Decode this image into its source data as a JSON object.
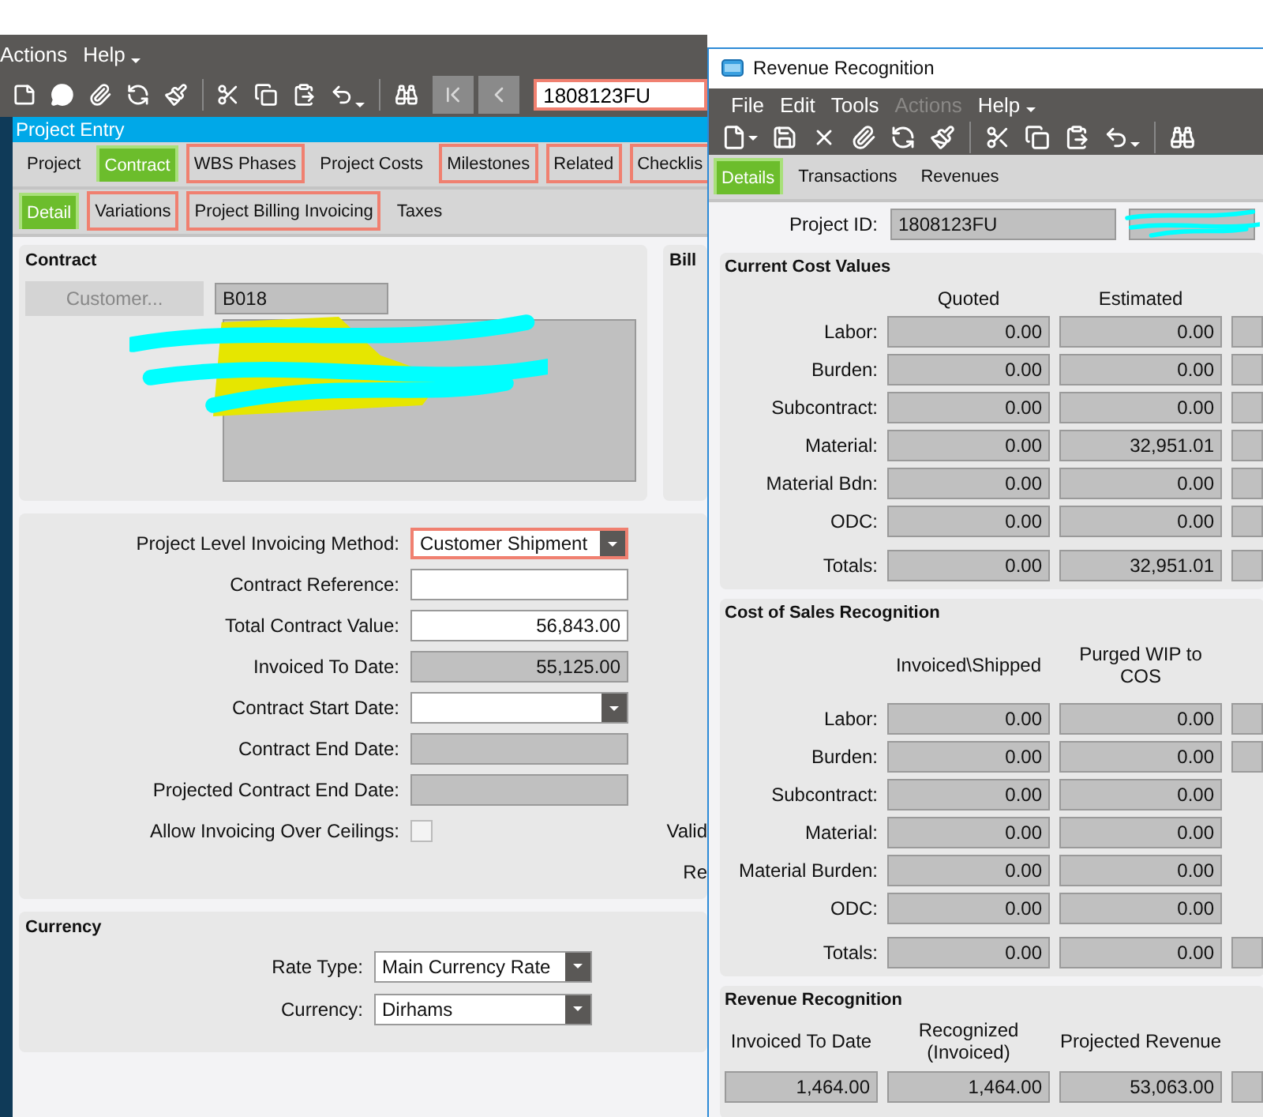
{
  "project_entry": {
    "menu": [
      {
        "label": "Actions",
        "disabled": false
      },
      {
        "label": "Help",
        "disabled": false
      }
    ],
    "record_field": {
      "value": "1808123FU",
      "highlighted": true
    },
    "title": "Project Entry",
    "tabs": [
      {
        "label": "Project",
        "selected": false,
        "highlighted": false
      },
      {
        "label": "Contract",
        "selected": true,
        "highlighted": false
      },
      {
        "label": "WBS Phases",
        "selected": false,
        "highlighted": true
      },
      {
        "label": "Project Costs",
        "selected": false,
        "highlighted": false
      },
      {
        "label": "Milestones",
        "selected": false,
        "highlighted": true
      },
      {
        "label": "Related",
        "selected": false,
        "highlighted": true
      },
      {
        "label": "Checklis",
        "selected": false,
        "highlighted": true
      }
    ],
    "subtabs": [
      {
        "label": "Detail",
        "selected": true,
        "highlighted": false
      },
      {
        "label": "Variations",
        "selected": false,
        "highlighted": true
      },
      {
        "label": "Project Billing Invoicing",
        "selected": false,
        "highlighted": true
      },
      {
        "label": "Taxes",
        "selected": false,
        "highlighted": false
      }
    ],
    "contract": {
      "heading": "Contract",
      "customer_button": {
        "label": "Customer...",
        "disabled": true
      },
      "customer_id": "B018"
    },
    "bill_to": {
      "heading": "Bill"
    },
    "fields": [
      {
        "label": "Project Level Invoicing Method:",
        "kind": "dropdown",
        "value": "Customer Shipment",
        "highlighted": true
      },
      {
        "label": "Contract Reference:",
        "kind": "text",
        "highlighted": false
      },
      {
        "label": "Total Contract Value:",
        "kind": "text",
        "value": "56,843.00",
        "highlighted": false
      },
      {
        "label": "Invoiced To Date:",
        "kind": "readonly",
        "value": "55,125.00",
        "highlighted": false
      },
      {
        "label": "Contract Start Date:",
        "kind": "dropdown",
        "highlighted": false
      },
      {
        "label": "Contract End Date:",
        "kind": "readonly",
        "highlighted": false
      },
      {
        "label": "Projected Contract End Date:",
        "kind": "readonly",
        "highlighted": false
      },
      {
        "label": "Allow Invoicing Over Ceilings:",
        "kind": "checkbox",
        "checked": false,
        "side_label": "Valid"
      },
      {
        "kind": "blank",
        "side_label": "Re"
      }
    ],
    "currency": {
      "heading": "Currency",
      "fields": [
        {
          "label": "Rate Type:",
          "value": "Main Currency Rate"
        },
        {
          "label": "Currency:",
          "value": "Dirhams"
        }
      ]
    }
  },
  "revenue_recognition": {
    "title": "Revenue Recognition",
    "menu": [
      {
        "label": "File",
        "disabled": false
      },
      {
        "label": "Edit",
        "disabled": false
      },
      {
        "label": "Tools",
        "disabled": false
      },
      {
        "label": "Actions",
        "disabled": true
      },
      {
        "label": "Help",
        "disabled": false
      }
    ],
    "tabs": [
      {
        "label": "Details",
        "selected": true
      },
      {
        "label": "Transactions",
        "selected": false
      },
      {
        "label": "Revenues",
        "selected": false
      }
    ],
    "project_id": {
      "label": "Project ID:",
      "value": "1808123FU"
    },
    "current_cost_values": {
      "heading": "Current Cost Values",
      "columns": [
        "Quoted",
        "Estimated"
      ],
      "rows": [
        {
          "label": "Labor:",
          "values": [
            "0.00",
            "0.00"
          ],
          "cut_field": true
        },
        {
          "label": "Burden:",
          "values": [
            "0.00",
            "0.00"
          ],
          "cut_field": true
        },
        {
          "label": "Subcontract:",
          "values": [
            "0.00",
            "0.00"
          ],
          "cut_field": true
        },
        {
          "label": "Material:",
          "values": [
            "0.00",
            "32,951.01"
          ],
          "cut_field": true
        },
        {
          "label": "Material Bdn:",
          "values": [
            "0.00",
            "0.00"
          ],
          "cut_field": true
        },
        {
          "label": "ODC:",
          "values": [
            "0.00",
            "0.00"
          ],
          "cut_field": true
        }
      ],
      "totals": {
        "label": "Totals:",
        "values": [
          "0.00",
          "32,951.01"
        ],
        "cut_field": true
      }
    },
    "cost_of_sales_recognition": {
      "heading": "Cost of Sales Recognition",
      "columns": [
        "Invoiced\\Shipped",
        "Purged WIP to COS"
      ],
      "rows": [
        {
          "label": "Labor:",
          "values": [
            "0.00",
            "0.00"
          ],
          "cut_field": true
        },
        {
          "label": "Burden:",
          "values": [
            "0.00",
            "0.00"
          ],
          "cut_field": true
        },
        {
          "label": "Subcontract:",
          "values": [
            "0.00",
            "0.00"
          ],
          "cut_field": false
        },
        {
          "label": "Material:",
          "values": [
            "0.00",
            "0.00"
          ],
          "cut_field": false
        },
        {
          "label": "Material Burden:",
          "values": [
            "0.00",
            "0.00"
          ],
          "cut_field": false
        },
        {
          "label": "ODC:",
          "values": [
            "0.00",
            "0.00"
          ],
          "cut_field": false
        }
      ],
      "totals": {
        "label": "Totals:",
        "values": [
          "0.00",
          "0.00"
        ],
        "cut_field": true
      }
    },
    "revenue_recognition": {
      "heading": "Revenue Recognition",
      "columns": [
        "Invoiced To Date",
        "Recognized (Invoiced)",
        "Projected Revenue"
      ],
      "values": [
        "1,464.00",
        "1,464.00",
        "53,063.00"
      ]
    }
  }
}
